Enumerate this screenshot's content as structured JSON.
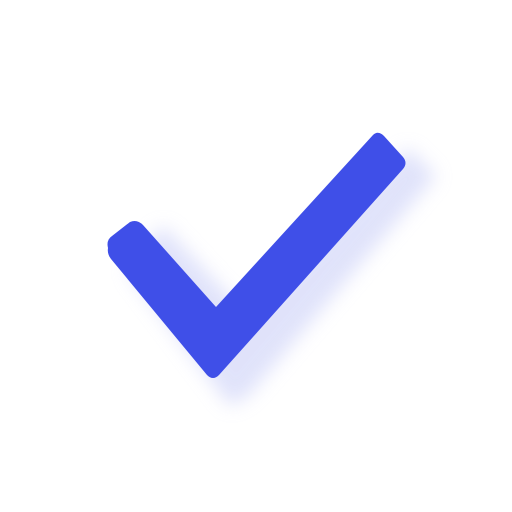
{
  "icon": {
    "name": "checkmark-icon",
    "color": "#3f4fe8",
    "shadow_color": "#c7ccf7",
    "background": "#ffffff"
  }
}
